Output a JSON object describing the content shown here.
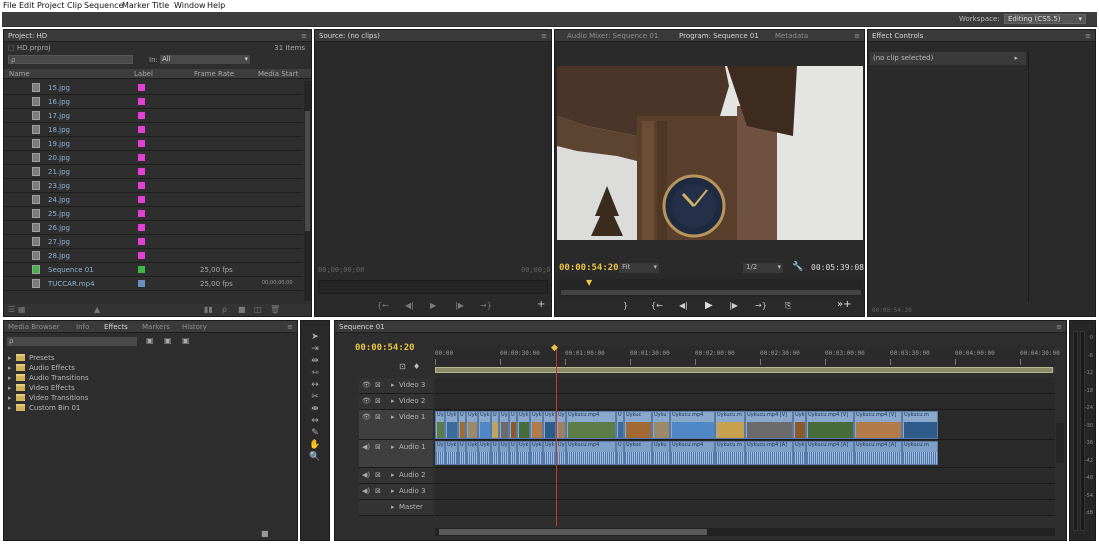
{
  "menu": [
    "File",
    "Edit",
    "Project",
    "Clip",
    "Sequence",
    "Marker",
    "Title",
    "Window",
    "Help"
  ],
  "workspace": {
    "label": "Workspace:",
    "value": "Editing (CS5.5)"
  },
  "project": {
    "tab": "Project: HD",
    "file": "HD.prproj",
    "count": "31 Items",
    "search_placeholder": "",
    "in_label": "In:",
    "in_value": "All",
    "columns": [
      "Name",
      "Label",
      "Frame Rate",
      "Media Start"
    ],
    "items": [
      {
        "name": "15.jpg",
        "rate": "",
        "start": ""
      },
      {
        "name": "16.jpg",
        "rate": "",
        "start": ""
      },
      {
        "name": "17.jpg",
        "rate": "",
        "start": ""
      },
      {
        "name": "18.jpg",
        "rate": "",
        "start": ""
      },
      {
        "name": "19.jpg",
        "rate": "",
        "start": ""
      },
      {
        "name": "20.jpg",
        "rate": "",
        "start": ""
      },
      {
        "name": "21.jpg",
        "rate": "",
        "start": ""
      },
      {
        "name": "23.jpg",
        "rate": "",
        "start": ""
      },
      {
        "name": "24.jpg",
        "rate": "",
        "start": ""
      },
      {
        "name": "25.jpg",
        "rate": "",
        "start": ""
      },
      {
        "name": "26.jpg",
        "rate": "",
        "start": ""
      },
      {
        "name": "27.jpg",
        "rate": "",
        "start": ""
      },
      {
        "name": "28.jpg",
        "rate": "",
        "start": ""
      },
      {
        "name": "Sequence 01",
        "rate": "25,00 fps",
        "start": ""
      },
      {
        "name": "TUCCAR.mp4",
        "rate": "25,00 fps",
        "start": "00;00;00;00"
      }
    ],
    "label_color": "#e23fd3",
    "seq_color": "#3fb54a",
    "mp4_color": "#6b8fbf"
  },
  "source": {
    "tab": "Source: (no clips)",
    "tc_left": "00;00;00;00",
    "tc_right": "00;00;0"
  },
  "program": {
    "tabs": [
      "Audio Mixer: Sequence 01",
      "Program: Sequence 01",
      "Metadata"
    ],
    "tc": "00:00:54:20",
    "fit": "Fit",
    "res": "1/2",
    "duration": "00:05:39:08"
  },
  "effect_controls": {
    "tab": "Effect Controls",
    "no_clip": "(no clip selected)",
    "footer_tc": "00:00:54:20"
  },
  "effects": {
    "tabs": [
      "Media Browser",
      "Info",
      "Effects",
      "Markers",
      "History"
    ],
    "items": [
      "Presets",
      "Audio Effects",
      "Audio Transitions",
      "Video Effects",
      "Video Transitions",
      "Custom Bin 01"
    ]
  },
  "timeline": {
    "tab": "Sequence 01",
    "tc": "00:00:54:20",
    "ruler": [
      "00:00",
      "00:00:30:00",
      "00:01:00:00",
      "00:01:30:00",
      "00:02:00:00",
      "00:02:30:00",
      "00:03:00:00",
      "00:03:30:00",
      "00:04:00:00",
      "00:04:30:00"
    ],
    "tracks": [
      "Video 3",
      "Video 2",
      "Video 1",
      "Audio 1",
      "Audio 2",
      "Audio 3",
      "Master"
    ],
    "clip_v": [
      "Uyk",
      "Uyk",
      "U",
      "Uyk",
      "Uyk",
      "U",
      "Uy",
      "U",
      "Uyk",
      "Uyk",
      "Uyk",
      "Uy",
      "Uykucu.mp4",
      "U",
      "Uykuc",
      "Uyku",
      "Uykucu.mp4",
      "Uykucu.m",
      "Uykucu.mp4 [V]",
      "Uyk",
      "Uykucu.mp4 [V]",
      "Uykucu.mp4 [V]",
      "Uykucu.m"
    ],
    "clip_a": [
      "Uyk",
      "Uyk",
      "U",
      "Uyk",
      "Uyk",
      "U",
      "Uy",
      "U",
      "Uyk",
      "Uyk",
      "Uyk",
      "Uy",
      "Uykucu.mp4",
      "U",
      "Uykuc",
      "Uyku",
      "Uykucu.mp4",
      "Uykucu.m",
      "Uykucu.mp4 [A]",
      "Uyk",
      "Uykucu.mp4 [A]",
      "Uykucu.mp4 [A]",
      "Uykucu.m"
    ]
  },
  "meters": [
    "0",
    "-6",
    "-12",
    "-18",
    "-24",
    "-30",
    "-36",
    "-42",
    "-48",
    "-54",
    "dB"
  ]
}
